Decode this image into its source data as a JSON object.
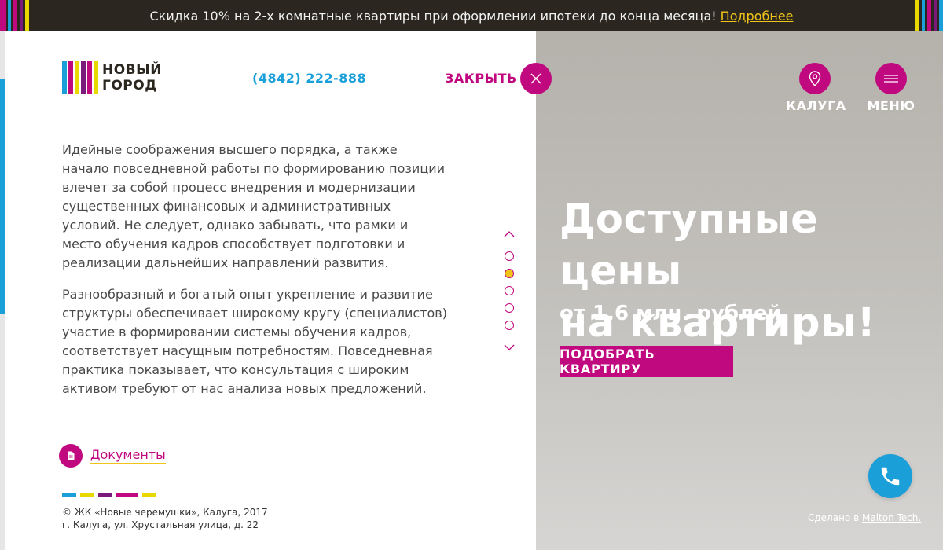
{
  "promo": {
    "text": "Скидка 10% на 2-х комнатные квартиры при оформлении ипотеки до конца месяца!",
    "link": "Подробнее"
  },
  "header": {
    "logo_line1": "НОВЫЙ",
    "logo_line2": "ГОРОД",
    "phone": "(4842) 222-888",
    "close_label": "ЗАКРЫТЬ",
    "city_label": "КАЛУГА",
    "menu_label": "МЕНЮ"
  },
  "article": {
    "paragraphs": [
      "Идейные соображения высшего порядка, а также начало повседневной работы по формированию позиции влечет за собой процесс внедрения и модернизации существенных финансовых и административных условий. Не следует, однако забывать, что рамки и место обучения кадров способствует подготовки и реализации дальнейших направлений развития.",
      "Разнообразный и богатый опыт укрепление и развитие структуры обеспечивает широкому кругу (специалистов) участие в формировании системы обучения кадров, соответствует насущным потребностям. Повседневная практика показывает, что консультация с широким активом требуют от нас анализа новых предложений."
    ]
  },
  "pager": {
    "active_index": 1
  },
  "documents": {
    "label": "Документы"
  },
  "footer": {
    "copyright": "© ЖК «Новые черемушки», Калуга, 2017",
    "address": "г. Калуга, ул. Хрустальная улица, д. 22",
    "made_by_prefix": "Сделано в",
    "made_by_link": "Malton Tech."
  },
  "hero": {
    "title_line1": "Доступные цены",
    "title_line2": "на квартиры!",
    "subtitle": "от 1,6 млн. рублей",
    "cta_label": "ПОДОБРАТЬ КВАРТИРУ"
  },
  "colors": {
    "magenta": "#c0087f",
    "blue": "#1a9fd8",
    "yellow": "#f0c419",
    "dark": "#2b2720"
  },
  "icons": {
    "close": "close-icon",
    "location": "location-pin-icon",
    "menu": "hamburger-icon",
    "document": "document-icon",
    "phone": "phone-icon",
    "pager_up": "chevron-up-icon",
    "pager_down": "chevron-down-icon"
  }
}
